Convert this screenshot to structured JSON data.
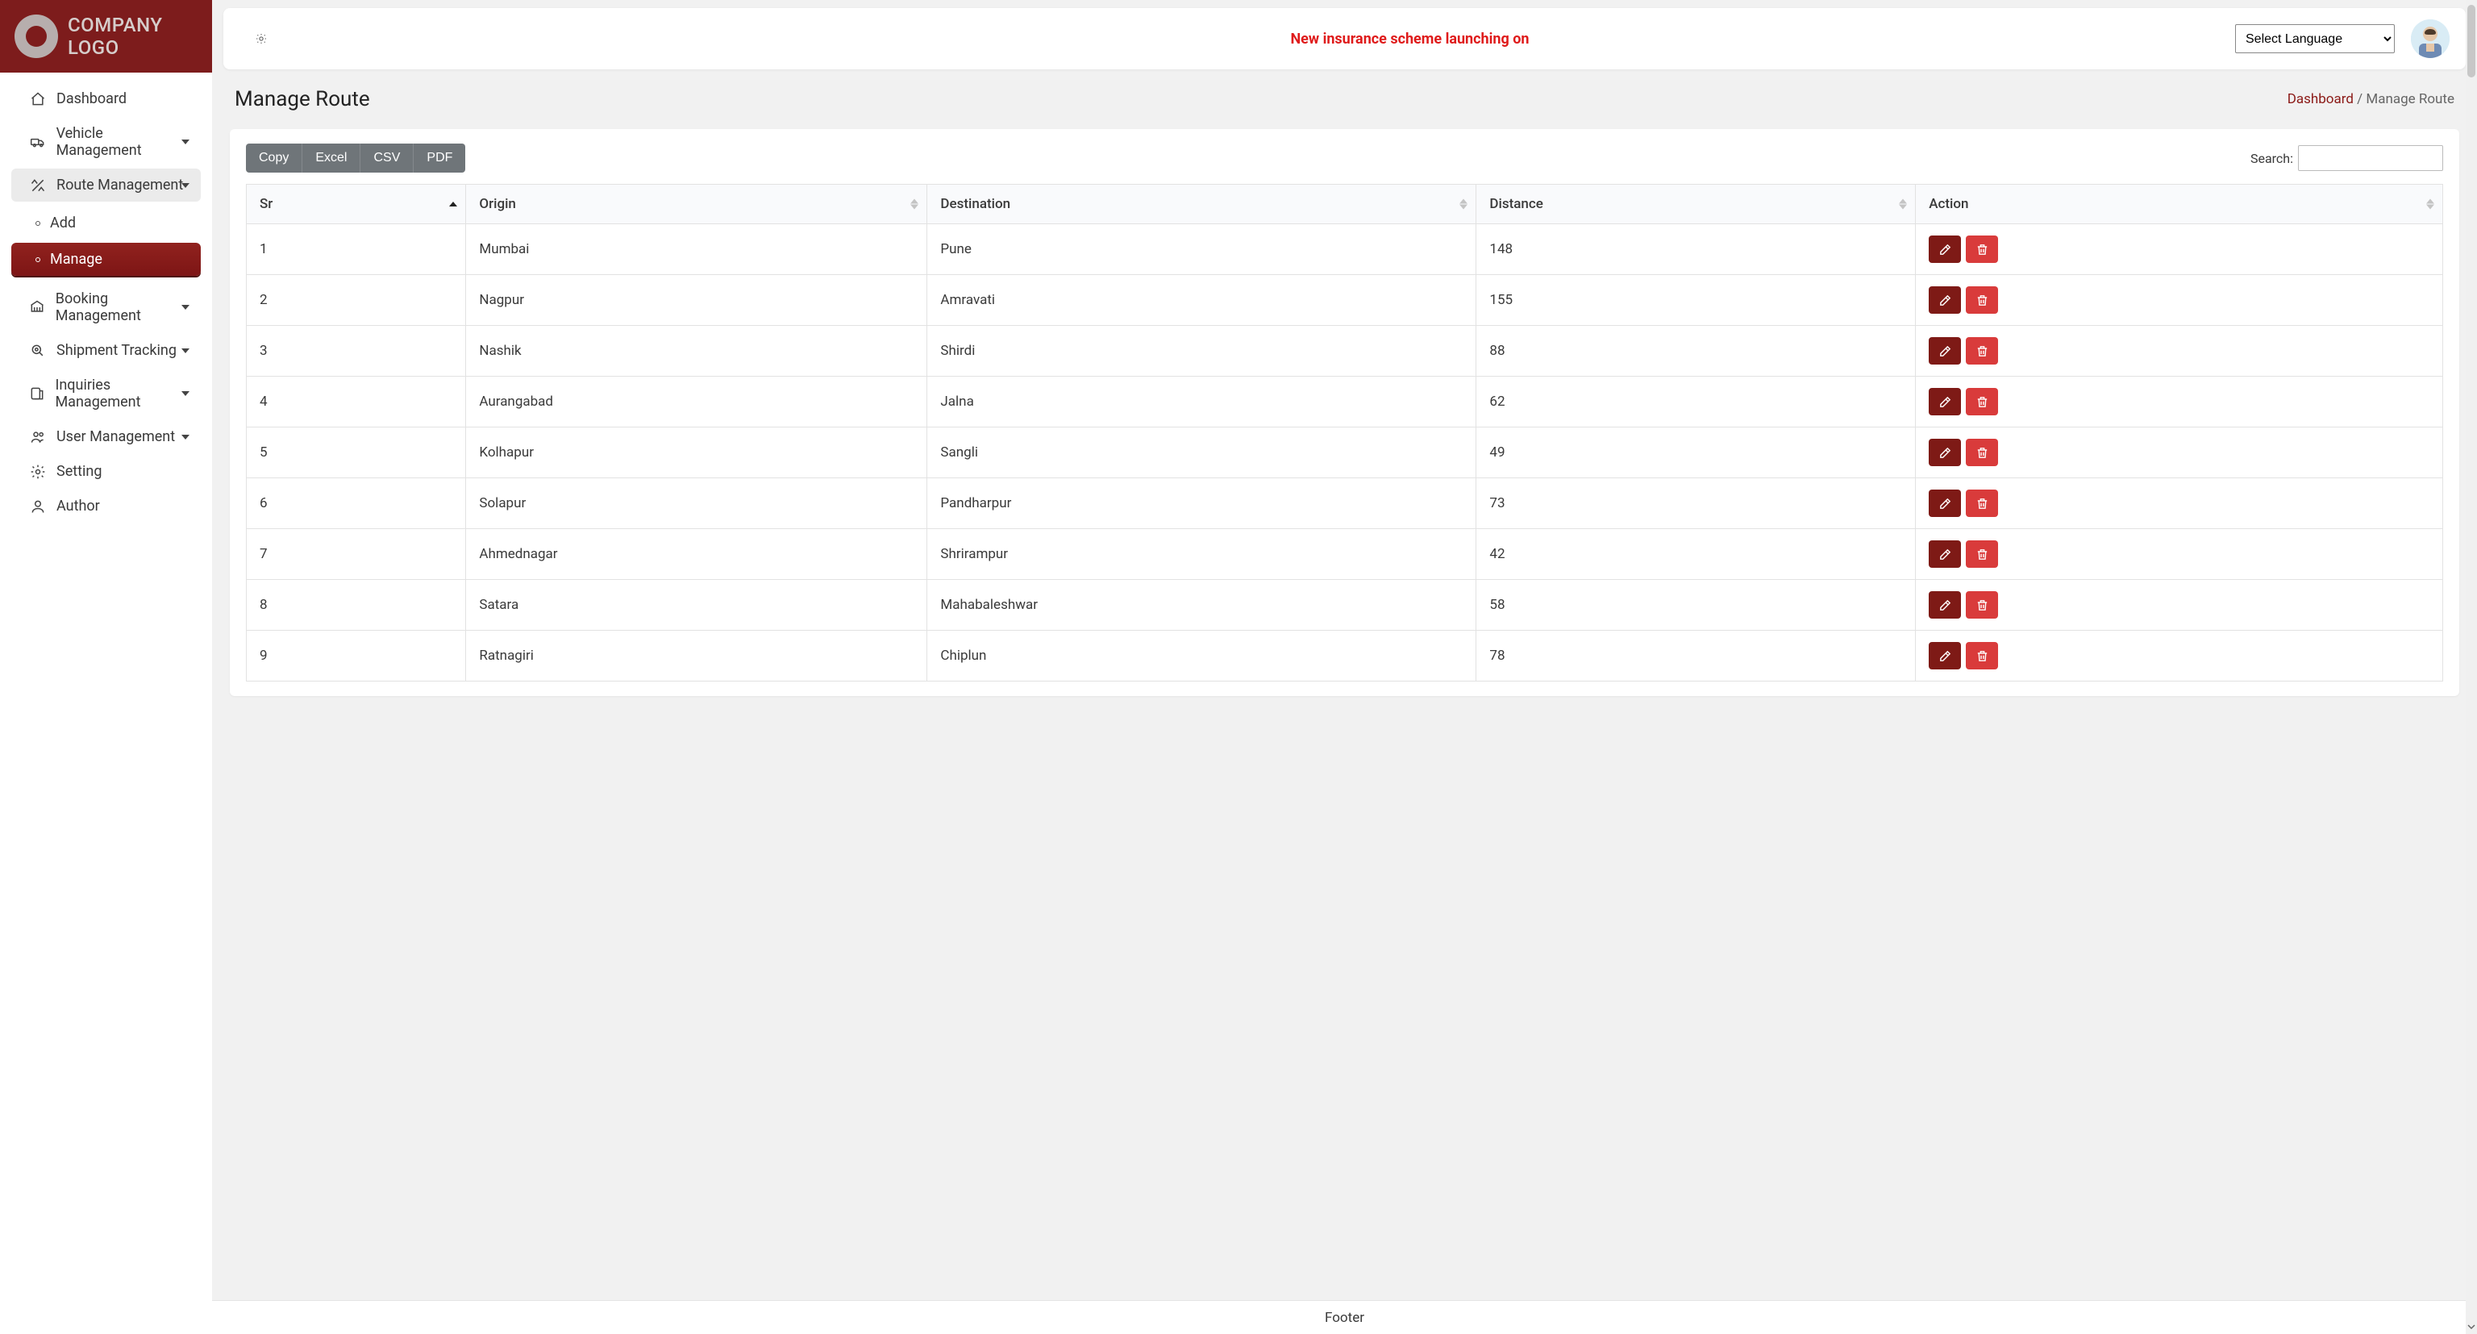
{
  "brand": {
    "line1": "COMPANY",
    "line2": "LOGO"
  },
  "nav": {
    "dashboard": "Dashboard",
    "vehicle": "Vehicle Management",
    "route": "Route Management",
    "route_children": {
      "add": "Add",
      "manage": "Manage"
    },
    "booking": "Booking Management",
    "shipment": "Shipment Tracking",
    "inquiries": "Inquiries Management",
    "user": "User Management",
    "setting": "Setting",
    "author": "Author"
  },
  "topbar": {
    "banner": "New insurance scheme launching on",
    "language_selected": "Select Language",
    "language_options": [
      "Select Language"
    ]
  },
  "page": {
    "title": "Manage Route",
    "breadcrumb_root": "Dashboard",
    "breadcrumb_sep": " / ",
    "breadcrumb_leaf": "Manage Route"
  },
  "toolbar": {
    "buttons": {
      "copy": "Copy",
      "excel": "Excel",
      "csv": "CSV",
      "pdf": "PDF"
    },
    "search_label": "Search:"
  },
  "table": {
    "headers": {
      "sr": "Sr",
      "origin": "Origin",
      "destination": "Destination",
      "distance": "Distance",
      "action": "Action"
    },
    "rows": [
      {
        "sr": "1",
        "origin": "Mumbai",
        "destination": "Pune",
        "distance": "148"
      },
      {
        "sr": "2",
        "origin": "Nagpur",
        "destination": "Amravati",
        "distance": "155"
      },
      {
        "sr": "3",
        "origin": "Nashik",
        "destination": "Shirdi",
        "distance": "88"
      },
      {
        "sr": "4",
        "origin": "Aurangabad",
        "destination": "Jalna",
        "distance": "62"
      },
      {
        "sr": "5",
        "origin": "Kolhapur",
        "destination": "Sangli",
        "distance": "49"
      },
      {
        "sr": "6",
        "origin": "Solapur",
        "destination": "Pandharpur",
        "distance": "73"
      },
      {
        "sr": "7",
        "origin": "Ahmednagar",
        "destination": "Shrirampur",
        "distance": "42"
      },
      {
        "sr": "8",
        "origin": "Satara",
        "destination": "Mahabaleshwar",
        "distance": "58"
      },
      {
        "sr": "9",
        "origin": "Ratnagiri",
        "destination": "Chiplun",
        "distance": "78"
      }
    ]
  },
  "footer": {
    "text": "Footer"
  }
}
